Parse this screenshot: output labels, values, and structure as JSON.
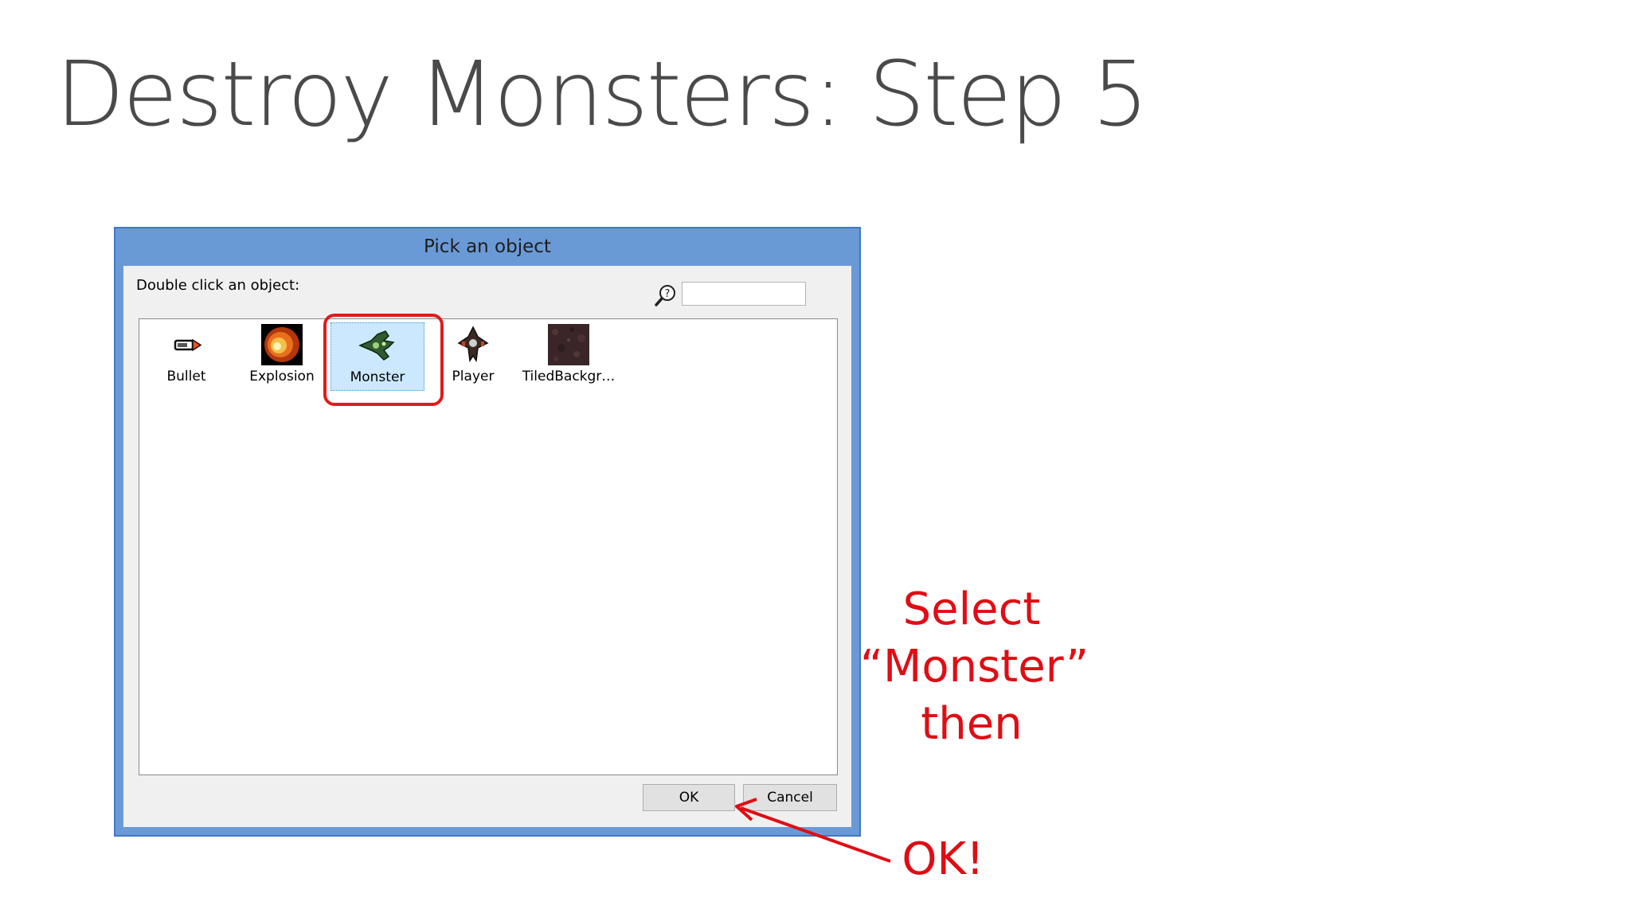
{
  "slide": {
    "title": "Destroy Monsters: Step 5"
  },
  "dialog": {
    "title": "Pick an object",
    "instruction": "Double click an object:",
    "search": {
      "value": "",
      "placeholder": ""
    },
    "objects": [
      {
        "label": "Bullet",
        "icon": "bullet-icon"
      },
      {
        "label": "Explosion",
        "icon": "explosion-icon"
      },
      {
        "label": "Monster",
        "icon": "monster-icon",
        "selected": true
      },
      {
        "label": "Player",
        "icon": "player-icon"
      },
      {
        "label": "TiledBackgr…",
        "icon": "tiled-background-icon"
      }
    ],
    "ok_label": "OK",
    "cancel_label": "Cancel"
  },
  "annotations": {
    "select_line1": "Select",
    "select_line2": "“Monster”",
    "select_line3": "then",
    "ok": "OK!",
    "color": "#e00d14"
  },
  "colors": {
    "dialog_frame": "#6a9ad6",
    "selection": "#cce8ff",
    "highlight": "#e01b1b"
  }
}
